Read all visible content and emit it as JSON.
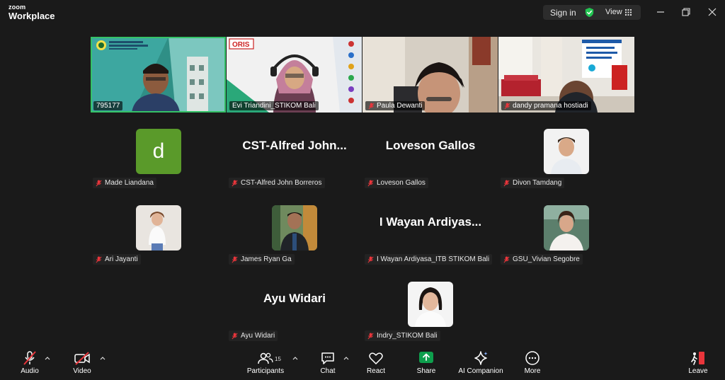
{
  "app": {
    "brand_top": "zoom",
    "brand_bottom": "Workplace"
  },
  "titlebar": {
    "signin_label": "Sign in",
    "view_label": "View"
  },
  "video_tiles": [
    {
      "name": "795177",
      "active": true
    },
    {
      "name": "Evi Triandini_STIKOM Bali",
      "active": false
    },
    {
      "name": "Paula Dewanti",
      "active": false
    },
    {
      "name": "dandy pramana hostiadi",
      "active": false
    }
  ],
  "tiles": [
    {
      "display": "avatar",
      "avatar_letter": "d",
      "avatar_color": "#5a9a2a",
      "name": "Made Liandana"
    },
    {
      "display": "text",
      "big_name": "CST-Alfred John...",
      "name": "CST-Alfred John Borreros"
    },
    {
      "display": "text",
      "big_name": "Loveson Gallos",
      "name": "Loveson Gallos"
    },
    {
      "display": "photo",
      "name": "Divon Tamdang"
    },
    {
      "display": "photo",
      "name": "Ari Jayanti"
    },
    {
      "display": "photo",
      "name": "James Ryan Ga"
    },
    {
      "display": "text",
      "big_name": "I Wayan Ardiyas...",
      "name": "I Wayan Ardiyasa_ITB STIKOM Bali"
    },
    {
      "display": "photo",
      "name": "GSU_Vivian Segobre"
    },
    {
      "display": "text",
      "big_name": "Ayu Widari",
      "name": "Ayu Widari"
    },
    {
      "display": "photo",
      "name": "Indry_STIKOM Bali"
    }
  ],
  "toolbar": {
    "audio_label": "Audio",
    "video_label": "Video",
    "participants_label": "Participants",
    "participants_count": "15",
    "chat_label": "Chat",
    "react_label": "React",
    "share_label": "Share",
    "ai_label": "AI Companion",
    "more_label": "More",
    "leave_label": "Leave"
  },
  "colors": {
    "background": "#1a1a1a",
    "active_speaker": "#35c267",
    "muted_red": "#e8353b",
    "share_green": "#0e9f4d",
    "shield_green": "#23c552"
  }
}
